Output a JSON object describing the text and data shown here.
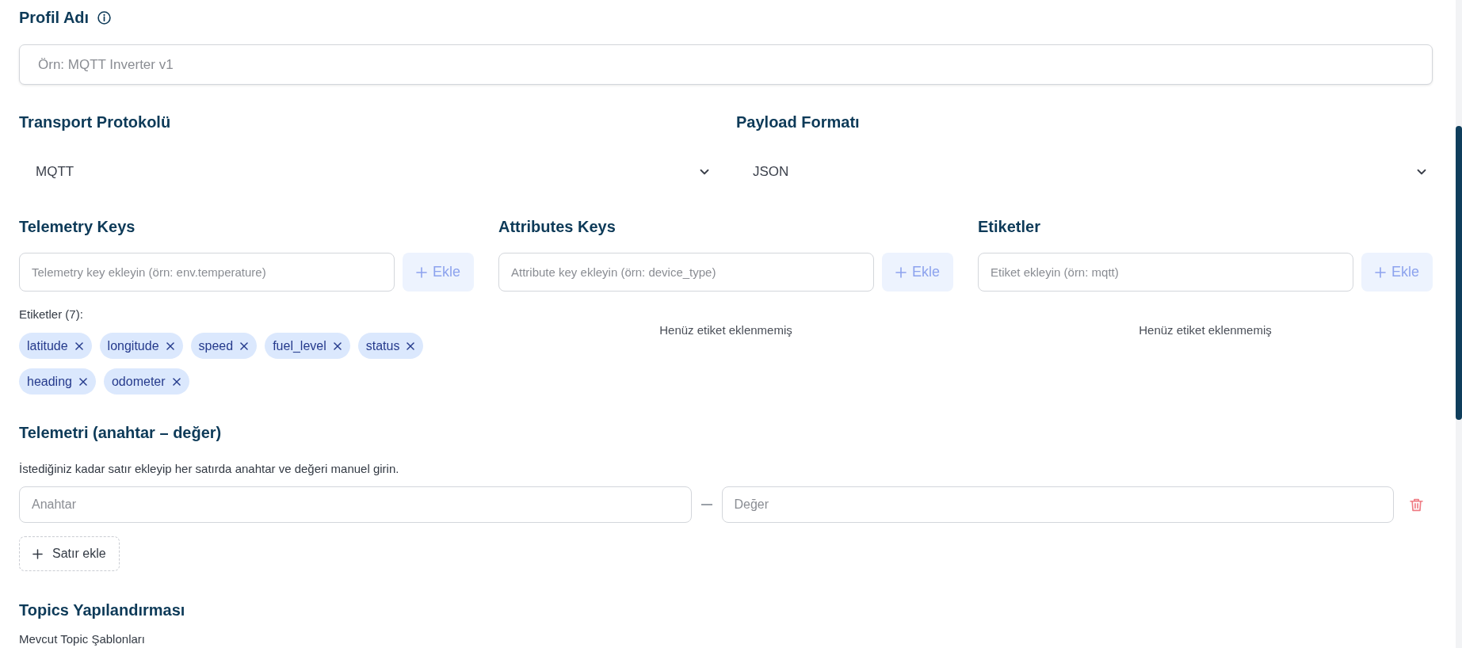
{
  "profile_name": {
    "label": "Profil Adı",
    "placeholder": "Örn: MQTT Inverter v1"
  },
  "selects": [
    {
      "label": "Transport Protokolü",
      "value": "MQTT"
    },
    {
      "label": "Payload Formatı",
      "value": "JSON"
    }
  ],
  "key_groups": [
    {
      "label": "Telemetry Keys",
      "placeholder": "Telemetry key ekleyin (örn: env.temperature)",
      "button": "Ekle",
      "tags_label": "Etiketler (7):",
      "tags": [
        "latitude",
        "longitude",
        "speed",
        "fuel_level",
        "status",
        "heading",
        "odometer"
      ]
    },
    {
      "label": "Attributes Keys",
      "placeholder": "Attribute key ekleyin (örn: device_type)",
      "button": "Ekle",
      "empty_text": "Henüz etiket eklenmemiş"
    },
    {
      "label": "Etiketler",
      "placeholder": "Etiket ekleyin (örn: mqtt)",
      "button": "Ekle",
      "empty_text": "Henüz etiket eklenmemiş"
    }
  ],
  "telemetry": {
    "title": "Telemetri (anahtar – değer)",
    "description": "İstediğiniz kadar satır ekleyip her satırda anahtar ve değeri manuel girin.",
    "rows": [
      {
        "key_placeholder": "Anahtar",
        "value_placeholder": "Değer"
      }
    ],
    "add_row_button": "Satır ekle"
  },
  "topics": {
    "title": "Topics Yapılandırması",
    "subtitle": "Mevcut Topic Şablonları"
  }
}
